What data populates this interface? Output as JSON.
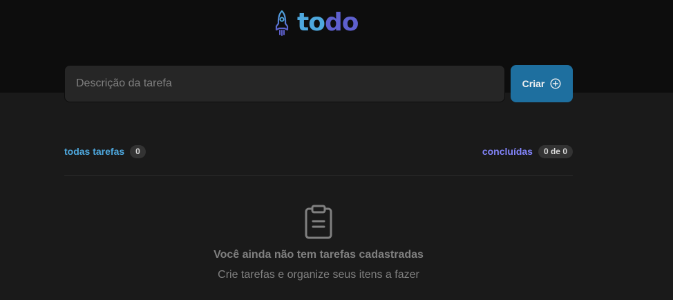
{
  "header": {
    "logo_part1": "to",
    "logo_part2": "do",
    "logo_icon": "rocket-icon"
  },
  "new_task": {
    "placeholder": "Descrição da tarefa",
    "value": "",
    "create_label": "Criar",
    "create_icon": "plus-circle-icon"
  },
  "summary": {
    "created_label": "todas tarefas",
    "created_count": "0",
    "done_label": "concluídas",
    "done_count": "0 de 0"
  },
  "empty_state": {
    "icon": "clipboard-icon",
    "title": "Você ainda não tem tarefas cadastradas",
    "subtitle": "Crie tarefas e organize seus itens a fazer"
  },
  "colors": {
    "header_bg": "#0d0d0d",
    "body_bg": "#1a1a1a",
    "blue": "#4ea8de",
    "blue_dark": "#1e6f9f",
    "purple": "#5e60ce",
    "purple_light": "#8284fa",
    "gray_text": "#808080"
  }
}
